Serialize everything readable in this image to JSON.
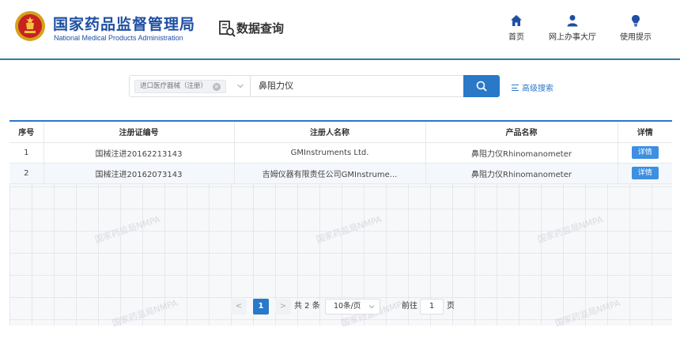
{
  "header": {
    "logo_cn": "国家药品监督管理局",
    "logo_en": "National Medical Products Administration",
    "section_title": "数据查询",
    "nav": [
      {
        "label": "首页",
        "icon": "home-icon"
      },
      {
        "label": "网上办事大厅",
        "icon": "user-icon"
      },
      {
        "label": "使用提示",
        "icon": "lightbulb-icon"
      }
    ]
  },
  "search": {
    "category_tag": "进口医疗器械（注册）",
    "query": "鼻阻力仪",
    "advanced_label": "高级搜索"
  },
  "table": {
    "columns": [
      "序号",
      "注册证编号",
      "注册人名称",
      "产品名称",
      "详情"
    ],
    "rows": [
      {
        "index": "1",
        "cert_no": "国械注进20162213143",
        "registrant": "GMInstruments Ltd.",
        "product": "鼻阻力仪Rhinomanometer",
        "detail": "详情"
      },
      {
        "index": "2",
        "cert_no": "国械注进20162073143",
        "registrant": "吉姆仪器有限责任公司GMInstrume...",
        "product": "鼻阻力仪Rhinomanometer",
        "detail": "详情"
      }
    ],
    "watermark": "国家药监局NMPA"
  },
  "pagination": {
    "prev": "<",
    "current_page": "1",
    "next": ">",
    "total": "共 2 条",
    "page_size": "10条/页",
    "goto_label": "前往",
    "goto_value": "1",
    "goto_suffix": "页"
  },
  "colors": {
    "brand_blue": "#1f4fa3",
    "accent": "#2a78c8"
  }
}
